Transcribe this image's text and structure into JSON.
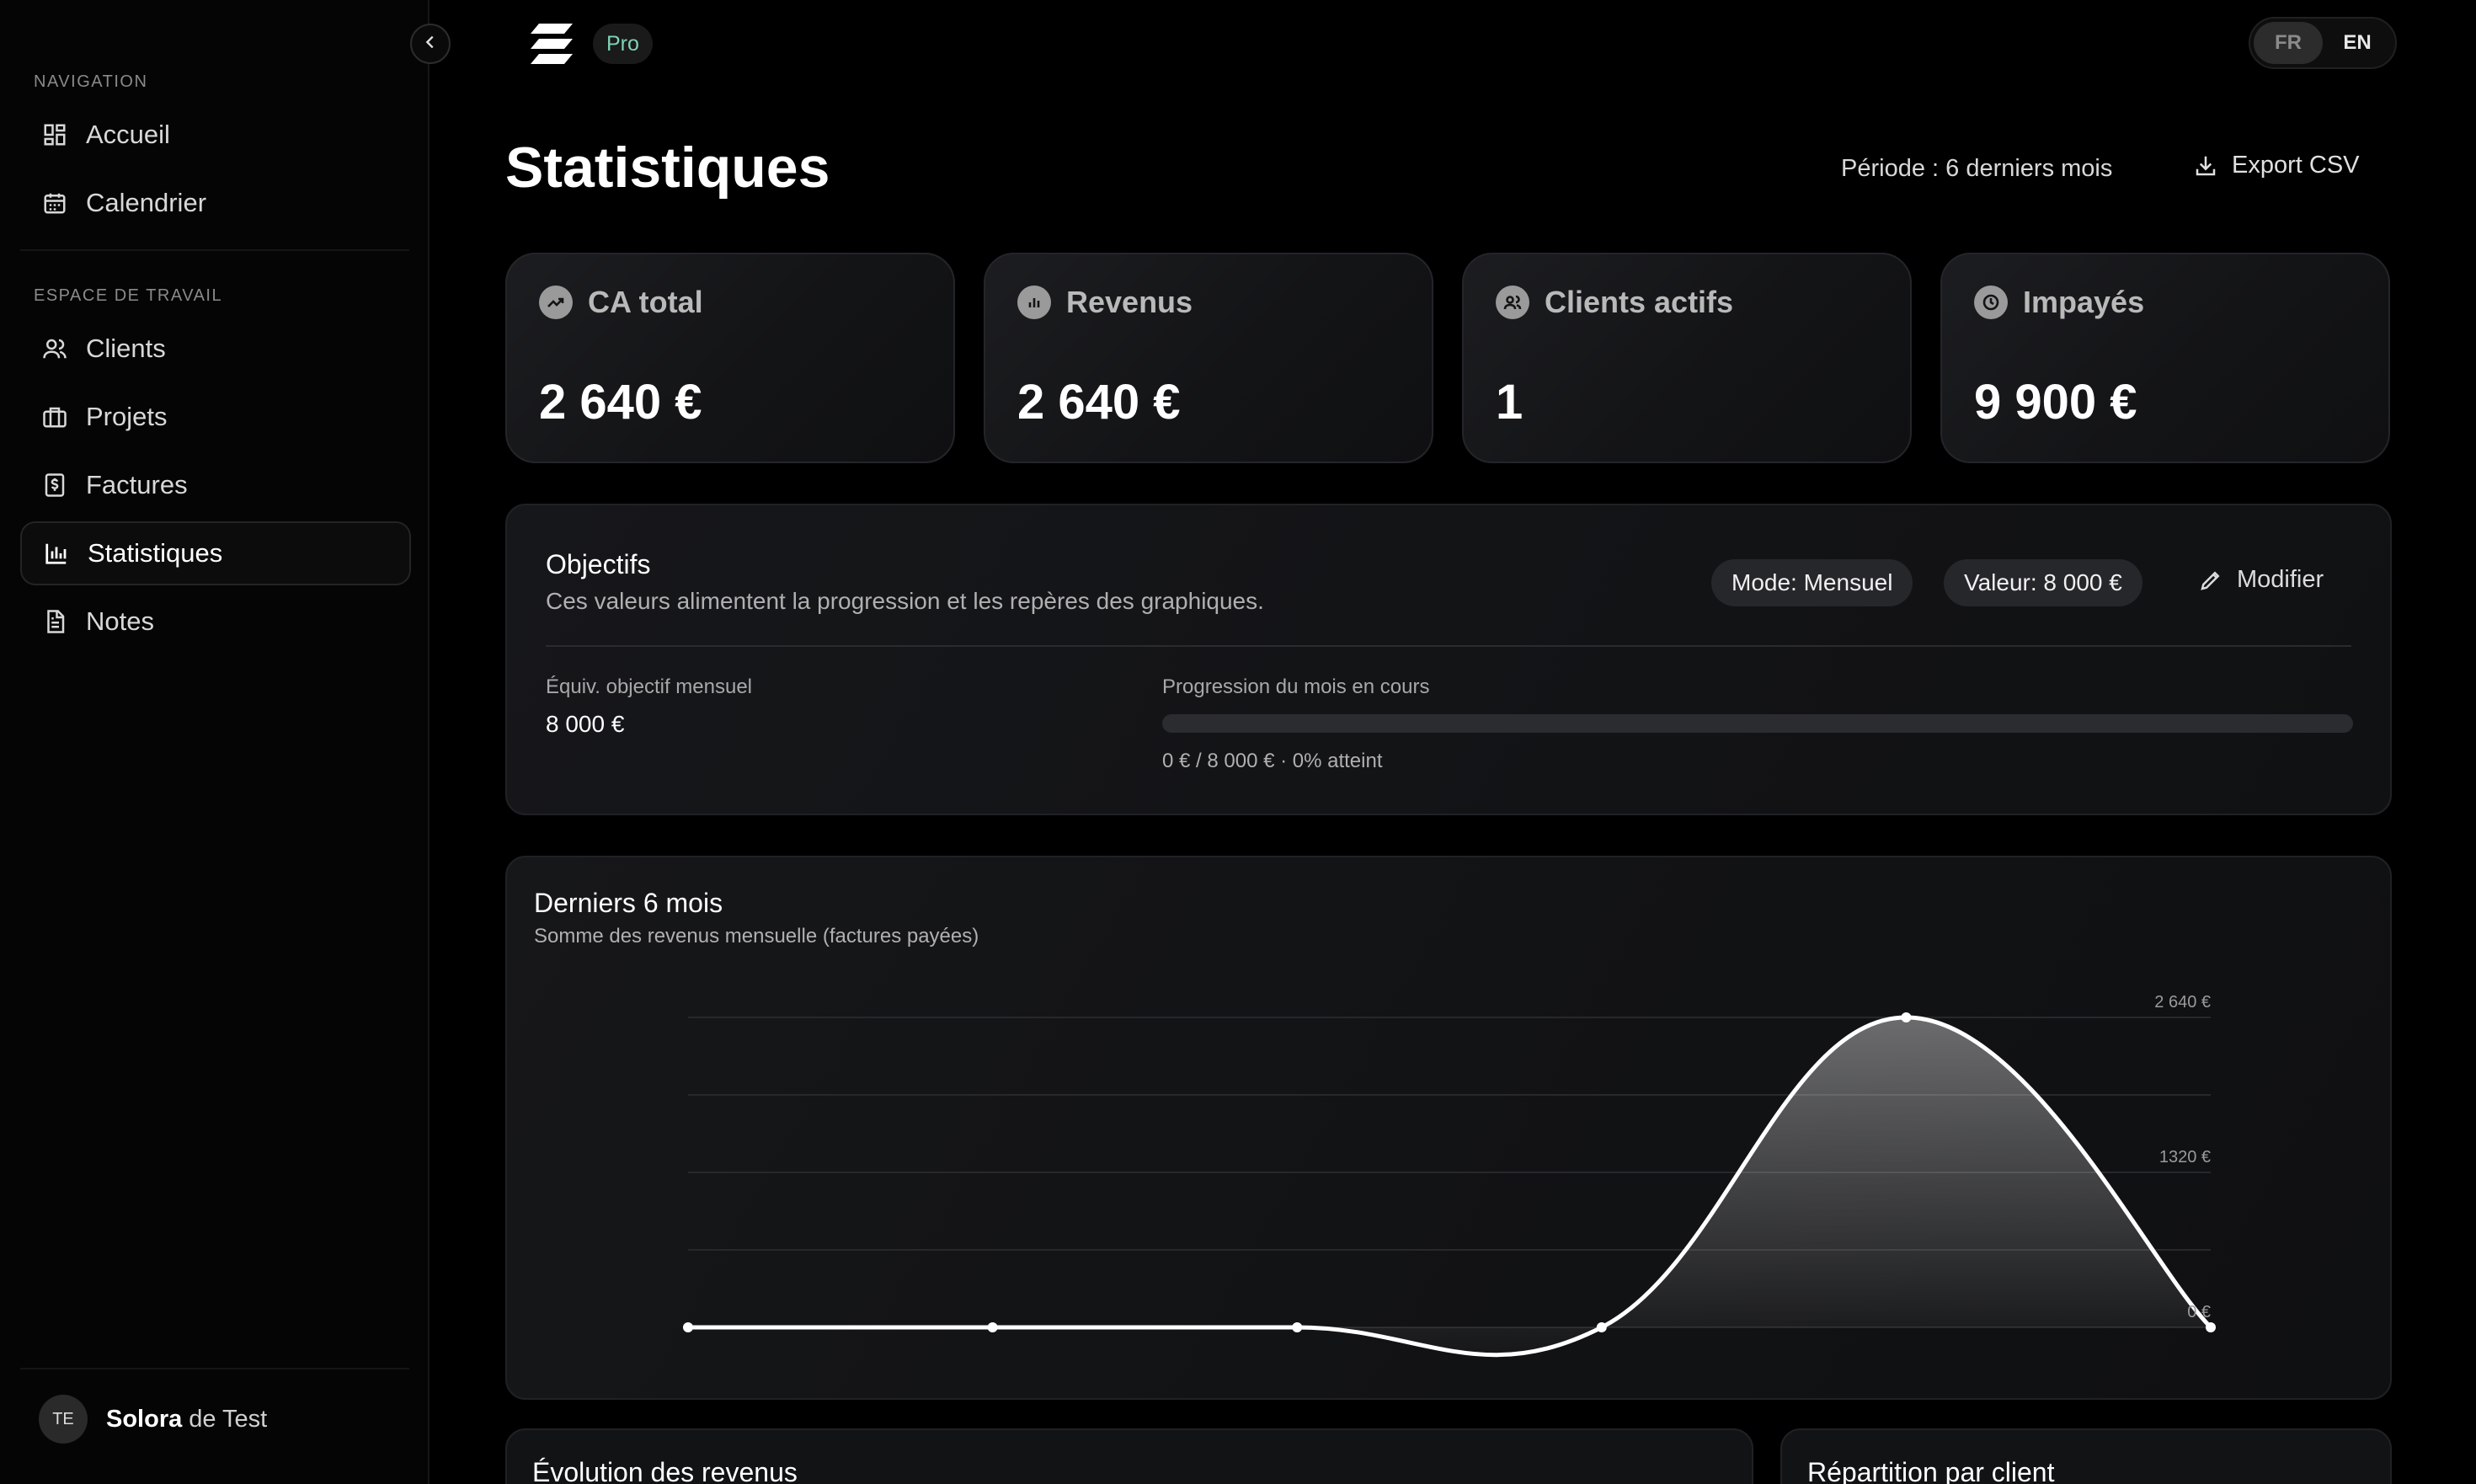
{
  "sidebar": {
    "section_nav": "NAVIGATION",
    "section_workspace": "ESPACE DE TRAVAIL",
    "items": [
      {
        "label": "Accueil",
        "icon": "dashboard-icon"
      },
      {
        "label": "Calendrier",
        "icon": "calendar-icon"
      },
      {
        "label": "Clients",
        "icon": "users-icon"
      },
      {
        "label": "Projets",
        "icon": "briefcase-icon"
      },
      {
        "label": "Factures",
        "icon": "invoice-icon"
      },
      {
        "label": "Statistiques",
        "icon": "bar-chart-icon",
        "active": true
      },
      {
        "label": "Notes",
        "icon": "note-icon"
      }
    ],
    "user": {
      "initials": "TE",
      "first": "Solora",
      "last": "de Test"
    }
  },
  "topbar": {
    "badge": "Pro",
    "lang": {
      "fr": "FR",
      "en": "EN",
      "selected": "FR"
    }
  },
  "header": {
    "title": "Statistiques",
    "period": "Période : 6 derniers mois",
    "export": "Export CSV"
  },
  "kpis": [
    {
      "label": "CA total",
      "value": "2 640 €",
      "icon": "trending-up-icon"
    },
    {
      "label": "Revenus",
      "value": "2 640 €",
      "icon": "bar-chart-icon"
    },
    {
      "label": "Clients actifs",
      "value": "1",
      "icon": "users-icon"
    },
    {
      "label": "Impayés",
      "value": "9 900 €",
      "icon": "clock-icon"
    }
  ],
  "goals": {
    "title": "Objectifs",
    "subtitle": "Ces valeurs alimentent la progression et les repères des graphiques.",
    "mode": "Mode: Mensuel",
    "value": "Valeur: 8 000 €",
    "modify": "Modifier",
    "monthly_label": "Équiv. objectif mensuel",
    "monthly_value": "8 000 €",
    "progress_label": "Progression du mois en cours",
    "progress_text": "0 € / 8 000 € · 0% atteint",
    "progress_percent": 0
  },
  "chart": {
    "title": "Derniers 6 mois",
    "subtitle": "Somme des revenus mensuelle (factures payées)",
    "tick_labels": [
      "2 640 €",
      "1320 €",
      "0 €"
    ]
  },
  "chart_data": {
    "type": "area",
    "title": "Derniers 6 mois",
    "subtitle": "Somme des revenus mensuelle (factures payées)",
    "values": [
      0,
      0,
      0,
      0,
      2640,
      0
    ],
    "ylim": [
      0,
      2640
    ],
    "yticks": [
      0,
      1320,
      2640
    ],
    "grid": true,
    "legend": "none"
  },
  "bottom": {
    "left_title": "Évolution des revenus",
    "right_title": "Répartition par client"
  },
  "colors": {
    "background": "#000000",
    "card": "#131416",
    "accent_pro": "#7fd3b2",
    "line": "#ffffff"
  }
}
